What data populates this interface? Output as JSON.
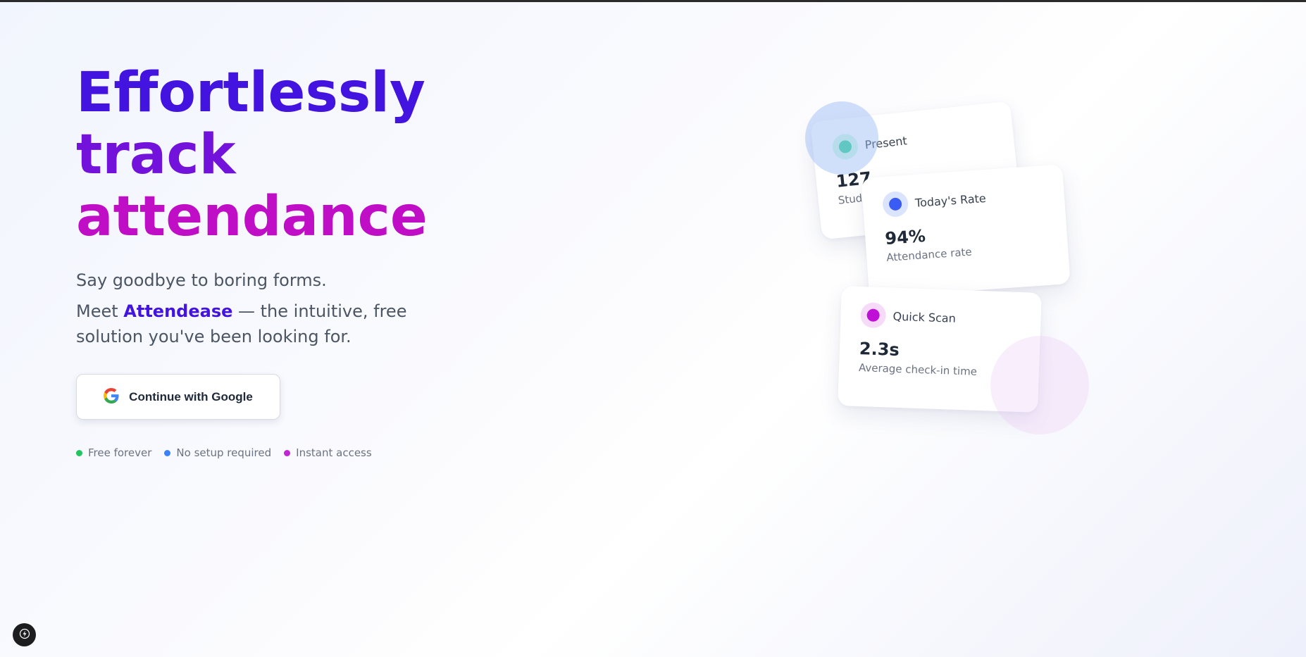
{
  "hero": {
    "headline_line1": "Effortlessly",
    "headline_line2": "track",
    "headline_line3": "attendance",
    "subtitle": "Say goodbye to boring forms.",
    "tagline_prefix": "Meet ",
    "brand_name": "Attendease",
    "tagline_suffix": " — the intuitive, free solution you've been looking for."
  },
  "auth": {
    "google_button_label": "Continue with Google",
    "google_icon": "google-g-icon"
  },
  "features": [
    {
      "label": "Free forever",
      "color": "#22c55e"
    },
    {
      "label": "No setup required",
      "color": "#3b82f6"
    },
    {
      "label": "Instant access",
      "color": "#c026d3"
    }
  ],
  "cards": {
    "present": {
      "title": "Present",
      "value": "127",
      "caption": "Students",
      "color": "#34d399",
      "ring": "#d1fae5"
    },
    "rate": {
      "title": "Today's Rate",
      "value": "94%",
      "caption": "Attendance rate",
      "color": "#3b5bf5",
      "ring": "#dbe4fd"
    },
    "scan": {
      "title": "Quick Scan",
      "value": "2.3s",
      "caption": "Average check-in time",
      "color": "#c010d8",
      "ring": "#f5dbf8"
    }
  },
  "colors": {
    "headline_line1": "#4313e0",
    "headline_line2": "#7212db",
    "headline_line3": "#c00ec7",
    "brand": "#4313e0"
  },
  "dev_indicator": {
    "icon": "lightning-icon"
  }
}
